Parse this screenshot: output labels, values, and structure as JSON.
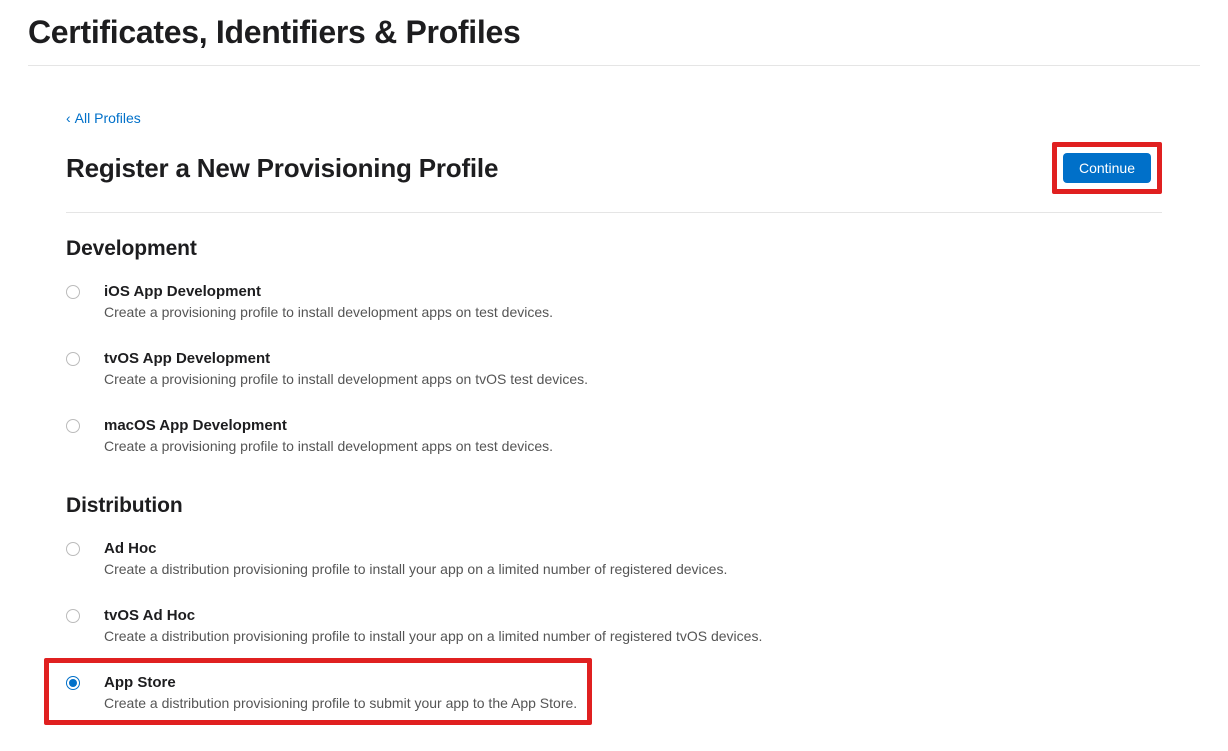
{
  "header": {
    "title": "Certificates, Identifiers & Profiles"
  },
  "back": {
    "label": "All Profiles"
  },
  "subheader": {
    "title": "Register a New Provisioning Profile",
    "continue_label": "Continue"
  },
  "sections": [
    {
      "title": "Development",
      "options": [
        {
          "id": "ios-dev",
          "title": "iOS App Development",
          "desc": "Create a provisioning profile to install development apps on test devices.",
          "checked": false
        },
        {
          "id": "tvos-dev",
          "title": "tvOS App Development",
          "desc": "Create a provisioning profile to install development apps on tvOS test devices.",
          "checked": false
        },
        {
          "id": "macos-dev",
          "title": "macOS App Development",
          "desc": "Create a provisioning profile to install development apps on test devices.",
          "checked": false
        }
      ]
    },
    {
      "title": "Distribution",
      "options": [
        {
          "id": "adhoc",
          "title": "Ad Hoc",
          "desc": "Create a distribution provisioning profile to install your app on a limited number of registered devices.",
          "checked": false
        },
        {
          "id": "tvos-adhoc",
          "title": "tvOS Ad Hoc",
          "desc": "Create a distribution provisioning profile to install your app on a limited number of registered tvOS devices.",
          "checked": false
        },
        {
          "id": "appstore",
          "title": "App Store",
          "desc": "Create a distribution provisioning profile to submit your app to the App Store.",
          "checked": true
        }
      ]
    }
  ]
}
